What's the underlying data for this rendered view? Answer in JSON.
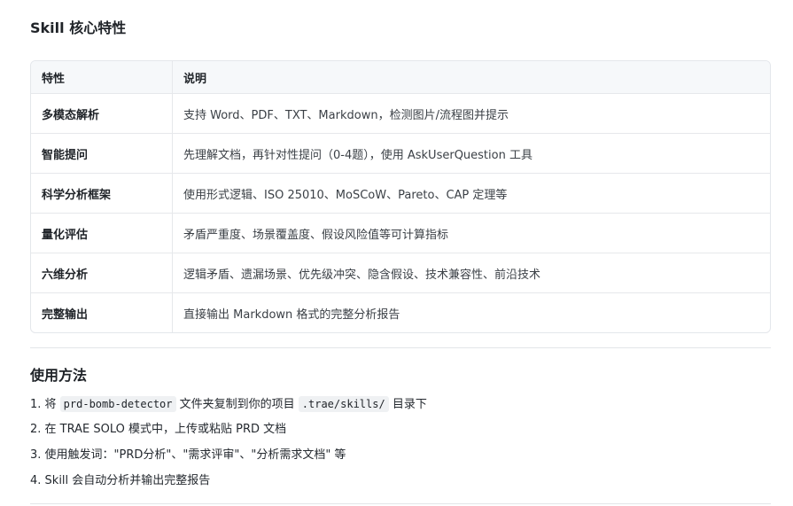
{
  "section1": {
    "title": "Skill 核心特性"
  },
  "table": {
    "headers": [
      "特性",
      "说明"
    ],
    "rows": [
      [
        "多模态解析",
        "支持 Word、PDF、TXT、Markdown，检测图片/流程图并提示"
      ],
      [
        "智能提问",
        "先理解文档，再针对性提问（0-4题），使用 AskUserQuestion 工具"
      ],
      [
        "科学分析框架",
        "使用形式逻辑、ISO 25010、MoSCoW、Pareto、CAP 定理等"
      ],
      [
        "量化评估",
        "矛盾严重度、场景覆盖度、假设风险值等可计算指标"
      ],
      [
        "六维分析",
        "逻辑矛盾、遗漏场景、优先级冲突、隐含假设、技术兼容性、前沿技术"
      ],
      [
        "完整输出",
        "直接输出 Markdown 格式的完整分析报告"
      ]
    ]
  },
  "section2": {
    "title": "使用方法",
    "step1": {
      "a": "1. 将 ",
      "code1": "prd-bomb-detector",
      "b": " 文件夹复制到你的项目 ",
      "code2": ".trae/skills/",
      "c": " 目录下"
    },
    "step2": "2. 在 TRAE SOLO 模式中，上传或粘贴 PRD 文档",
    "step3": "3. 使用触发词：\"PRD分析\"、\"需求评审\"、\"分析需求文档\" 等",
    "step4": "4. Skill 会自动分析并输出完整报告"
  }
}
